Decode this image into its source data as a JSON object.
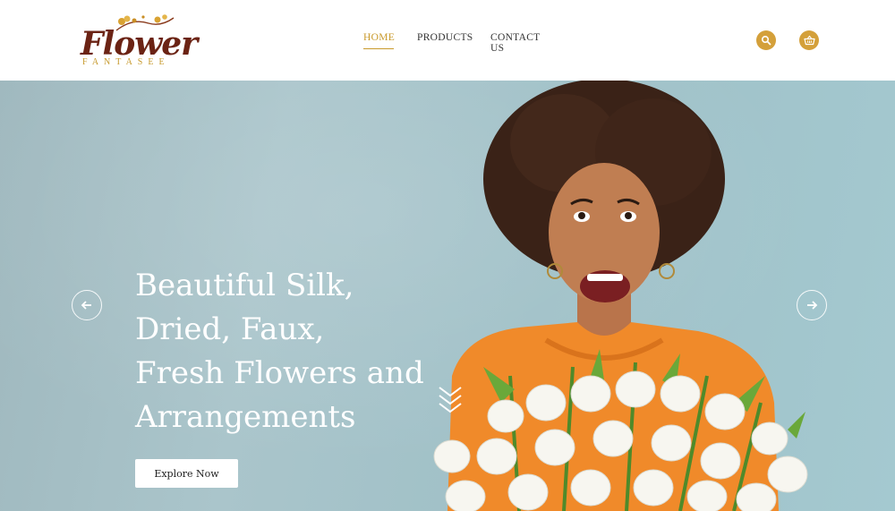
{
  "brand": {
    "script": "Flower",
    "sub": "FANTASEE",
    "colors": {
      "script": "#6b2314",
      "accent": "#c99a2b"
    }
  },
  "nav": {
    "items": [
      {
        "label": "HOME",
        "active": true
      },
      {
        "label": "PRODUCTS",
        "active": false
      },
      {
        "label": "CONTACT US",
        "active": false
      }
    ]
  },
  "header_icons": {
    "search": "search-icon",
    "cart": "basket-icon"
  },
  "hero": {
    "title_lines": [
      "Beautiful Silk,",
      "Dried, Faux,",
      "Fresh Flowers and",
      "Arrangements"
    ],
    "cta_label": "Explore Now",
    "prev_icon": "arrow-left-icon",
    "next_icon": "arrow-right-icon",
    "scroll_icon": "chevrons-down-icon"
  }
}
